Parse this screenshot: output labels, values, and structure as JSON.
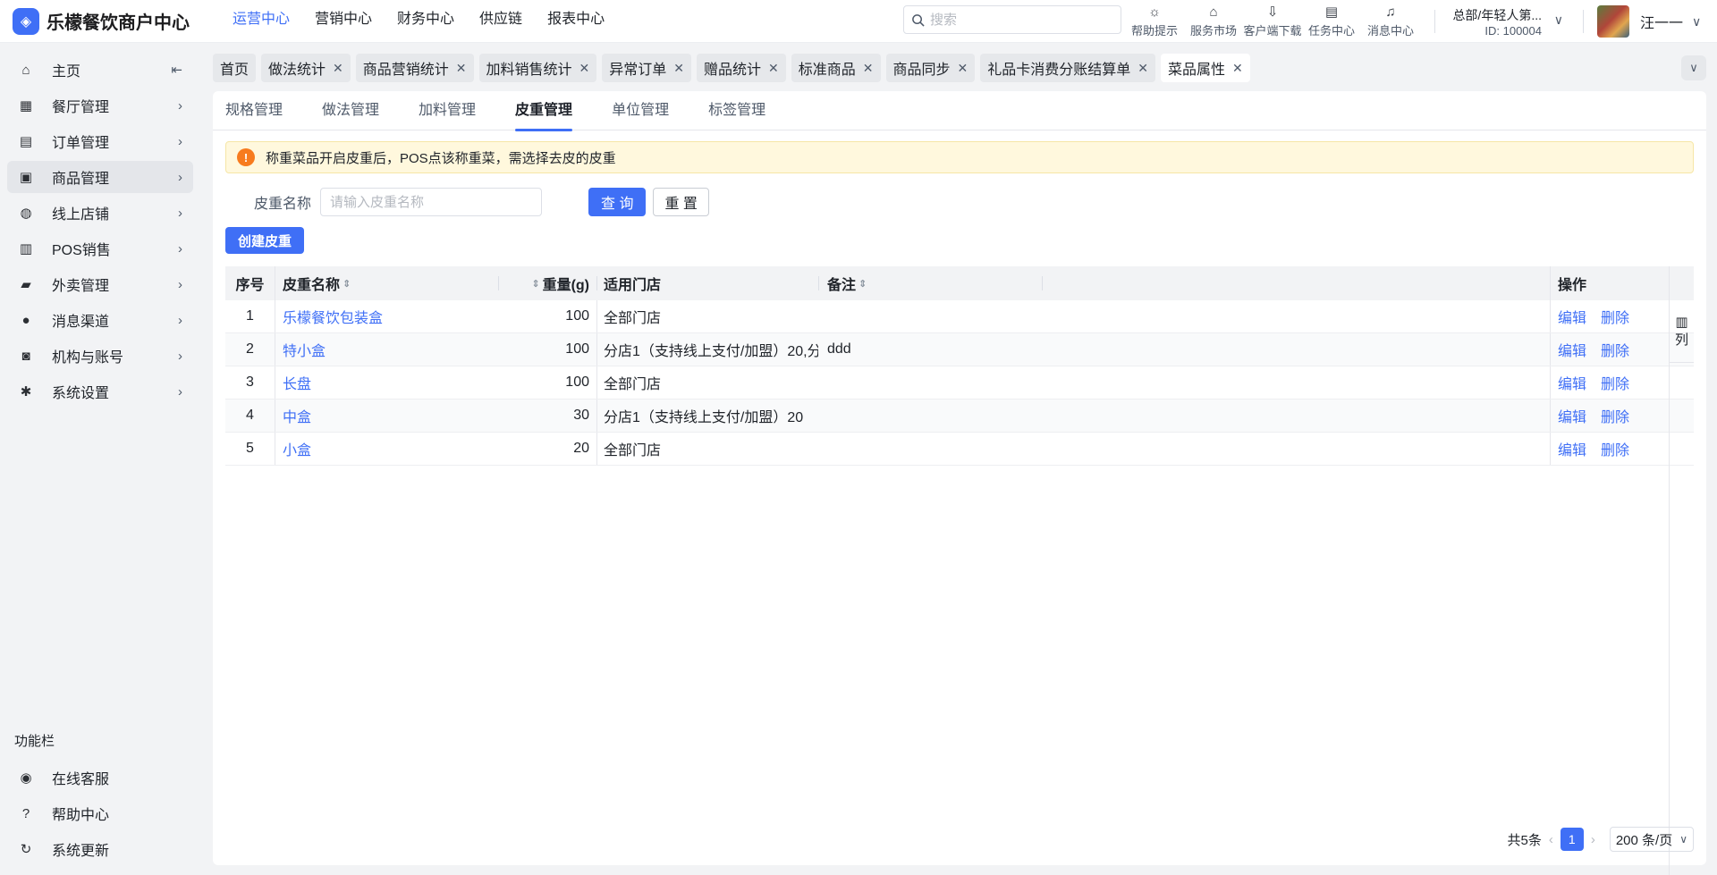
{
  "app": {
    "logo_glyph": "◈",
    "title": "乐檬餐饮商户中心"
  },
  "topnav": [
    {
      "label": "运营中心",
      "active": true
    },
    {
      "label": "营销中心"
    },
    {
      "label": "财务中心"
    },
    {
      "label": "供应链"
    },
    {
      "label": "报表中心"
    }
  ],
  "search": {
    "placeholder": "搜索"
  },
  "tools": [
    {
      "icon": "lightbulb-icon",
      "label": "帮助提示"
    },
    {
      "icon": "store-icon",
      "label": "服务市场"
    },
    {
      "icon": "download-icon",
      "label": "客户端下载"
    },
    {
      "icon": "clipboard-icon",
      "label": "任务中心"
    },
    {
      "icon": "bell-icon",
      "label": "消息中心"
    }
  ],
  "account": {
    "org": "总部/年轻人第...",
    "id": "ID: 100004"
  },
  "user": {
    "name": "汪一一"
  },
  "sidebar": {
    "items": [
      {
        "icon": "home-icon",
        "label": "主页"
      },
      {
        "icon": "restaurant-icon",
        "label": "餐厅管理"
      },
      {
        "icon": "order-icon",
        "label": "订单管理"
      },
      {
        "icon": "product-icon",
        "label": "商品管理",
        "active": true
      },
      {
        "icon": "globe-icon",
        "label": "线上店铺"
      },
      {
        "icon": "pos-icon",
        "label": "POS销售"
      },
      {
        "icon": "takeout-icon",
        "label": "外卖管理"
      },
      {
        "icon": "chat-icon",
        "label": "消息渠道"
      },
      {
        "icon": "org-icon",
        "label": "机构与账号"
      },
      {
        "icon": "gear-icon",
        "label": "系统设置"
      }
    ],
    "group_title": "功能栏",
    "bottom": [
      {
        "icon": "headset-icon",
        "label": "在线客服"
      },
      {
        "icon": "help-icon",
        "label": "帮助中心"
      },
      {
        "icon": "refresh-icon",
        "label": "系统更新"
      }
    ]
  },
  "tabs": [
    {
      "label": "首页",
      "closable": false
    },
    {
      "label": "做法统计",
      "closable": true
    },
    {
      "label": "商品营销统计",
      "closable": true
    },
    {
      "label": "加料销售统计",
      "closable": true
    },
    {
      "label": "异常订单",
      "closable": true
    },
    {
      "label": "赠品统计",
      "closable": true
    },
    {
      "label": "标准商品",
      "closable": true
    },
    {
      "label": "商品同步",
      "closable": true
    },
    {
      "label": "礼品卡消费分账结算单",
      "closable": true
    },
    {
      "label": "菜品属性",
      "closable": true,
      "active": true
    }
  ],
  "subtabs": [
    {
      "label": "规格管理"
    },
    {
      "label": "做法管理"
    },
    {
      "label": "加料管理"
    },
    {
      "label": "皮重管理",
      "active": true
    },
    {
      "label": "单位管理"
    },
    {
      "label": "标签管理"
    }
  ],
  "alert": {
    "text": "称重菜品开启皮重后，POS点该称重菜，需选择去皮的皮重"
  },
  "filter": {
    "label": "皮重名称",
    "placeholder": "请输入皮重名称",
    "query_label": "查 询",
    "reset_label": "重 置"
  },
  "create_label": "创建皮重",
  "table": {
    "headers": {
      "idx": "序号",
      "name": "皮重名称",
      "weight": "重量(g)",
      "store": "适用门店",
      "note": "备注",
      "op": "操作",
      "cols": "列"
    },
    "rows": [
      {
        "idx": "1",
        "name": "乐檬餐饮包装盒",
        "weight": "100",
        "store": "全部门店",
        "note": ""
      },
      {
        "idx": "2",
        "name": "特小盒",
        "weight": "100",
        "store": "分店1（支持线上支付/加盟）20,分",
        "note": "ddd"
      },
      {
        "idx": "3",
        "name": "长盘",
        "weight": "100",
        "store": "全部门店",
        "note": ""
      },
      {
        "idx": "4",
        "name": "中盒",
        "weight": "30",
        "store": "分店1（支持线上支付/加盟）20",
        "note": ""
      },
      {
        "idx": "5",
        "name": "小盒",
        "weight": "20",
        "store": "全部门店",
        "note": ""
      }
    ],
    "edit_label": "编辑",
    "delete_label": "删除"
  },
  "pagination": {
    "total": "共5条",
    "current": "1",
    "page_size": "200 条/页"
  },
  "colors": {
    "accent": "#3f6ff6",
    "warning": "#f77b1e"
  }
}
